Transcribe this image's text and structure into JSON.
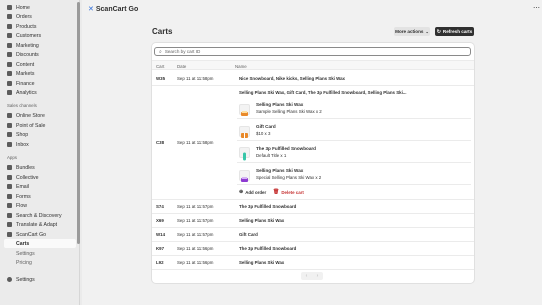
{
  "sidebar": {
    "items": [
      {
        "label": "Home",
        "icon": "home-icon"
      },
      {
        "label": "Orders",
        "icon": "orders-icon"
      },
      {
        "label": "Products",
        "icon": "products-icon"
      },
      {
        "label": "Customers",
        "icon": "customers-icon"
      },
      {
        "label": "Marketing",
        "icon": "marketing-icon"
      },
      {
        "label": "Discounts",
        "icon": "discounts-icon"
      },
      {
        "label": "Content",
        "icon": "content-icon"
      },
      {
        "label": "Markets",
        "icon": "markets-icon"
      },
      {
        "label": "Finance",
        "icon": "finance-icon"
      },
      {
        "label": "Analytics",
        "icon": "analytics-icon"
      }
    ],
    "sales_channels_label": "Sales channels",
    "channels": [
      {
        "label": "Online Store",
        "icon": "online-store-icon"
      },
      {
        "label": "Point of Sale",
        "icon": "pos-icon"
      },
      {
        "label": "Shop",
        "icon": "shop-icon"
      },
      {
        "label": "Inbox",
        "icon": "inbox-icon"
      }
    ],
    "apps_label": "Apps",
    "apps": [
      {
        "label": "Bundles",
        "icon": "bundles-icon"
      },
      {
        "label": "Collective",
        "icon": "collective-icon"
      },
      {
        "label": "Email",
        "icon": "email-icon"
      },
      {
        "label": "Forms",
        "icon": "forms-icon"
      },
      {
        "label": "Flow",
        "icon": "flow-icon"
      },
      {
        "label": "Search & Discovery",
        "icon": "search-discovery-icon"
      },
      {
        "label": "Translate & Adapt",
        "icon": "translate-icon"
      },
      {
        "label": "ScanCart Go",
        "icon": "scancart-icon"
      }
    ],
    "sub_items": [
      "Carts",
      "Settings",
      "Pricing"
    ],
    "settings_label": "Settings"
  },
  "appbar": {
    "title": "ScanCart Go",
    "more": "⋯"
  },
  "page": {
    "title": "Carts",
    "more_actions": "More actions",
    "refresh": "Refresh carts"
  },
  "search": {
    "placeholder": "Search by cart ID"
  },
  "table": {
    "headers": [
      "Cart",
      "Date",
      "Name"
    ],
    "rows": [
      {
        "cart": "W35",
        "date": "Sep 11 at 11:58pm",
        "name": "Nice Snowboard, Nike kicks, Selling Plans Ski Wax"
      },
      {
        "cart": "C38",
        "date": "Sep 11 at 11:58pm",
        "name": "Selling Plans Ski Wax, Gift Card, The 3p Fulfilled Snowboard, Selling Plans Ski..."
      },
      {
        "cart": "S74",
        "date": "Sep 11 at 11:57pm",
        "name": "The 3p Fulfilled Snowboard"
      },
      {
        "cart": "X69",
        "date": "Sep 11 at 11:57pm",
        "name": "Selling Plans Ski Wax"
      },
      {
        "cart": "W14",
        "date": "Sep 11 at 11:57pm",
        "name": "Gift Card"
      },
      {
        "cart": "K97",
        "date": "Sep 11 at 11:56pm",
        "name": "The 3p Fulfilled Snowboard"
      },
      {
        "cart": "L92",
        "date": "Sep 11 at 11:56pm",
        "name": "Selling Plans Ski Wax"
      }
    ],
    "expanded_items": [
      {
        "name": "Selling Plans Ski Wax",
        "sub": "Sample Selling Plans Ski Wax x 2"
      },
      {
        "name": "Gift Card",
        "sub": "$10 x 3"
      },
      {
        "name": "The 3p Fulfilled Snowboard",
        "sub": "Default Title x 1"
      },
      {
        "name": "Selling Plans Ski Wax",
        "sub": "Special Selling Plans Ski Wax x 2"
      }
    ],
    "add_order": "Add order",
    "delete_cart": "Delete cart"
  },
  "pager": {
    "prev": "‹",
    "next": "›"
  },
  "colors": {
    "accent": "#303030",
    "delete": "#c53030",
    "link": "#303030"
  }
}
